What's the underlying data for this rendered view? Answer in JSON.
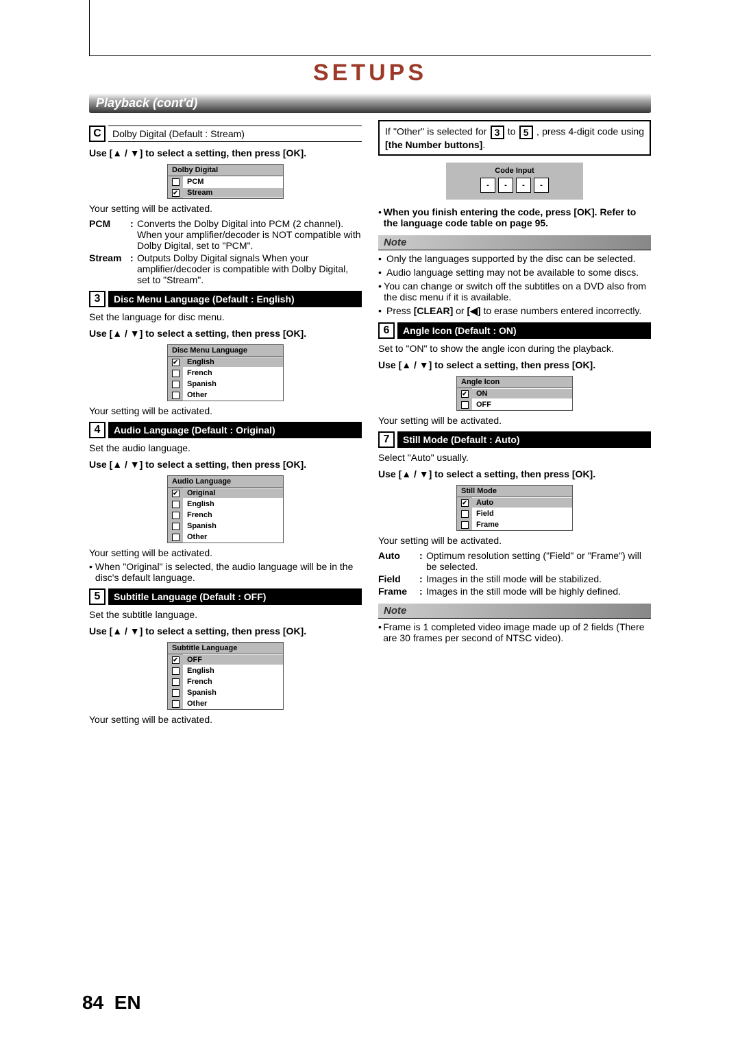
{
  "header": {
    "title": "SETUPS",
    "section": "Playback (cont'd)"
  },
  "left": {
    "stepC": {
      "badge": "C",
      "label": "Dolby Digital (Default : Stream)",
      "instr": "Use [▲ / ▼] to select a setting, then press [OK].",
      "menu_title": "Dolby Digital",
      "opt1": "PCM",
      "opt2": "Stream",
      "activated": "Your setting will be activated.",
      "pcm_term": "PCM",
      "pcm_body": "Converts the Dolby Digital into PCM (2 channel). When your amplifier/decoder is NOT compatible with Dolby Digital, set to \"PCM\".",
      "stream_term": "Stream",
      "stream_body": "Outputs Dolby Digital signals When your amplifier/decoder is compatible with Dolby Digital, set to \"Stream\"."
    },
    "step3": {
      "badge": "3",
      "label": "Disc Menu Language (Default : English)",
      "intro": "Set the language for disc menu.",
      "instr": "Use [▲ / ▼] to select a setting, then press [OK].",
      "menu_title": "Disc Menu Language",
      "o1": "English",
      "o2": "French",
      "o3": "Spanish",
      "o4": "Other",
      "activated": "Your setting will be activated."
    },
    "step4": {
      "badge": "4",
      "label": "Audio Language (Default : Original)",
      "intro": "Set the audio language.",
      "instr": "Use [▲ / ▼] to select a setting, then press [OK].",
      "menu_title": "Audio Language",
      "o1": "Original",
      "o2": "English",
      "o3": "French",
      "o4": "Spanish",
      "o5": "Other",
      "activated": "Your setting will be activated.",
      "note1": "When \"Original\" is selected, the audio language will be in the disc's default language."
    },
    "step5": {
      "badge": "5",
      "label": "Subtitle Language (Default : OFF)",
      "intro": "Set the subtitle language.",
      "instr": "Use [▲ / ▼] to select a setting, then press [OK].",
      "menu_title": "Subtitle Language",
      "o1": "OFF",
      "o2": "English",
      "o3": "French",
      "o4": "Spanish",
      "o5": "Other",
      "activated": "Your setting will be activated."
    }
  },
  "right": {
    "other_box_pre": "If \"Other\" is selected for ",
    "other_box_mid": " to ",
    "other_box_post": ", press 4-digit code using ",
    "other_box_bold": "[the Number buttons]",
    "other_box_end": ".",
    "b3": "3",
    "b5": "5",
    "code_title": "Code Input",
    "code_dash": "-",
    "finish": "When you finish entering the code, press [OK]. Refer to the language code table on page 95.",
    "note_label": "Note",
    "note_a": "Only the languages supported by the disc can be selected.",
    "note_b": "Audio language setting may not be available to some discs.",
    "note_c": "You can change or switch off the subtitles on a DVD also from the disc menu if it is available.",
    "note_d_pre": "Press ",
    "note_d_b1": "[CLEAR]",
    "note_d_mid": " or ",
    "note_d_b2": "[◀]",
    "note_d_post": " to erase numbers entered incorrectly.",
    "step6": {
      "badge": "6",
      "label": "Angle Icon (Default : ON)",
      "intro": "Set to \"ON\" to show the angle icon during the playback.",
      "instr": "Use [▲ / ▼] to select a setting, then press [OK].",
      "menu_title": "Angle Icon",
      "o1": "ON",
      "o2": "OFF",
      "activated": "Your setting will be activated."
    },
    "step7": {
      "badge": "7",
      "label": "Still Mode (Default : Auto)",
      "intro": "Select \"Auto\" usually.",
      "instr": "Use [▲ / ▼] to select a setting, then press [OK].",
      "menu_title": "Still Mode",
      "o1": "Auto",
      "o2": "Field",
      "o3": "Frame",
      "activated": "Your setting will be activated.",
      "auto_term": "Auto",
      "auto_body": "Optimum resolution setting (\"Field\" or \"Frame\") will be selected.",
      "field_term": "Field",
      "field_body": "Images in the still mode will be stabilized.",
      "frame_term": "Frame",
      "frame_body": "Images in the still mode will be highly defined."
    },
    "note2_label": "Note",
    "note2_a": "Frame is 1 completed video image made up of 2 fields (There are 30 frames per second of NTSC video)."
  },
  "footer": {
    "page": "84",
    "lang": "EN"
  }
}
